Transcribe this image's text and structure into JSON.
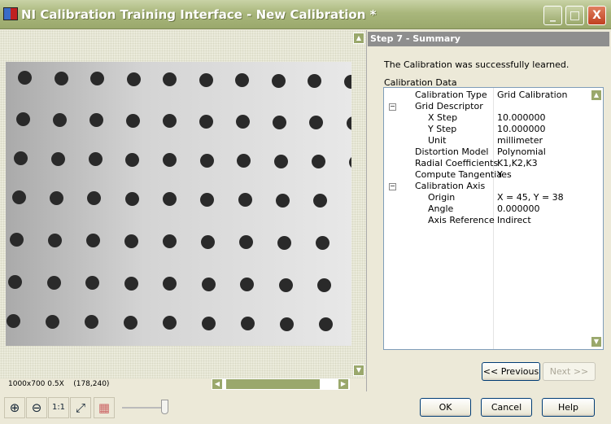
{
  "window": {
    "title": "NI Calibration Training Interface - New Calibration *",
    "minimize": "_",
    "maximize": "□",
    "close": "X"
  },
  "viewer": {
    "status_size": "1000x700 0.5X",
    "status_coords": "(178,240)",
    "tools": [
      {
        "icon": "zoom-in-icon",
        "glyph": "⊕"
      },
      {
        "icon": "zoom-out-icon",
        "glyph": "⊖"
      },
      {
        "icon": "zoom-1to1-icon",
        "glyph": "1:1"
      },
      {
        "icon": "zoom-fit-icon",
        "glyph": "⤢"
      },
      {
        "icon": "image-palette-icon",
        "glyph": "▦"
      }
    ],
    "zoom_slider_fraction": 0.9
  },
  "panel": {
    "step_title": "Step 7 - Summary",
    "message": "The Calibration was successfully learned.",
    "group_label": "Calibration Data",
    "tree": [
      {
        "name": "Calibration Type",
        "value": "Grid Calibration",
        "level": 0
      },
      {
        "name": "Grid Descriptor",
        "value": "",
        "level": 0,
        "expanded": true
      },
      {
        "name": "X Step",
        "value": "10.000000",
        "level": 1
      },
      {
        "name": "Y Step",
        "value": "10.000000",
        "level": 1
      },
      {
        "name": "Unit",
        "value": "millimeter",
        "level": 1
      },
      {
        "name": "Distortion Model",
        "value": "Polynomial",
        "level": 0
      },
      {
        "name": "Radial Coefficients",
        "value": "K1,K2,K3",
        "level": 0
      },
      {
        "name": "Compute Tangentia",
        "value": "Yes",
        "level": 0
      },
      {
        "name": "Calibration Axis",
        "value": "",
        "level": 0,
        "expanded": true
      },
      {
        "name": "Origin",
        "value": "X = 45, Y = 38",
        "level": 1
      },
      {
        "name": "Angle",
        "value": "0.000000",
        "level": 1
      },
      {
        "name": "Axis Reference",
        "value": "Indirect",
        "level": 1
      }
    ]
  },
  "nav": {
    "previous": "<< Previous",
    "next": "Next >>"
  },
  "footer": {
    "ok": "OK",
    "cancel": "Cancel",
    "help": "Help"
  }
}
